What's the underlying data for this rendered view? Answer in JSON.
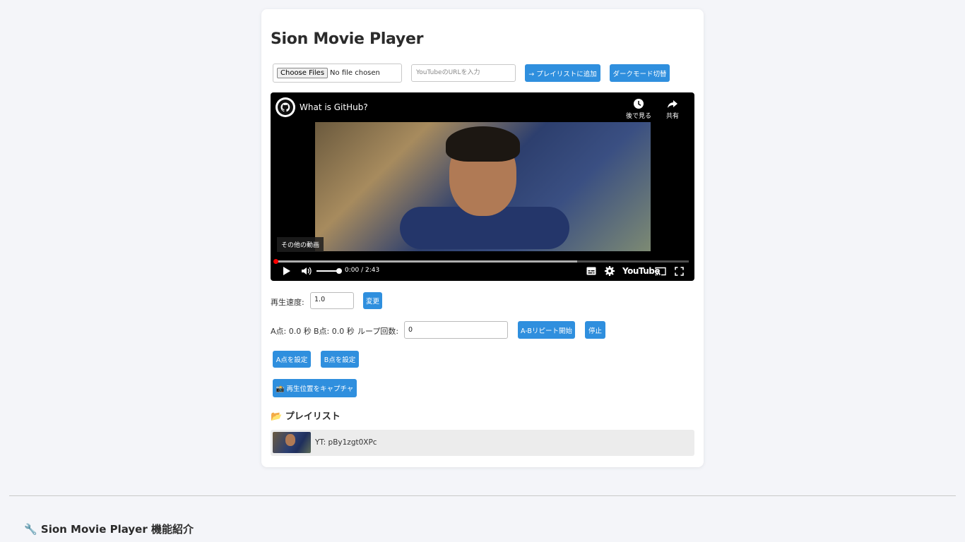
{
  "app": {
    "title": "Sion Movie Player"
  },
  "toolbar": {
    "file_button": "Choose Files",
    "file_status": "No file chosen",
    "url_placeholder": "YouTubeのURLを入力",
    "add_playlist": "→ プレイリストに追加",
    "dark_mode": "ダークモード切替"
  },
  "video": {
    "title": "What is GitHub?",
    "watch_later": "後で見る",
    "share": "共有",
    "more_videos": "その他の動画",
    "time": "0:00 / 2:43",
    "youtube_label": "YouTube",
    "progress_played": 0.0,
    "progress_loaded": 0.73
  },
  "speed": {
    "label": "再生速度:",
    "value": "1.0",
    "button": "変更"
  },
  "ab_repeat": {
    "a_label": "A点: 0.0 秒",
    "b_label": "B点: 0.0 秒",
    "loop_label": "ループ回数:",
    "loop_value": "0",
    "start_button": "A-Bリピート開始",
    "stop_button": "停止",
    "set_a": "A点を設定",
    "set_b": "B点を設定",
    "capture": "📸 再生位置をキャプチャ"
  },
  "playlist": {
    "title": "📂 プレイリスト",
    "items": [
      {
        "label": "YT: pBy1zgt0XPc"
      }
    ]
  },
  "footer": {
    "title": "🔧 Sion Movie Player 機能紹介"
  }
}
